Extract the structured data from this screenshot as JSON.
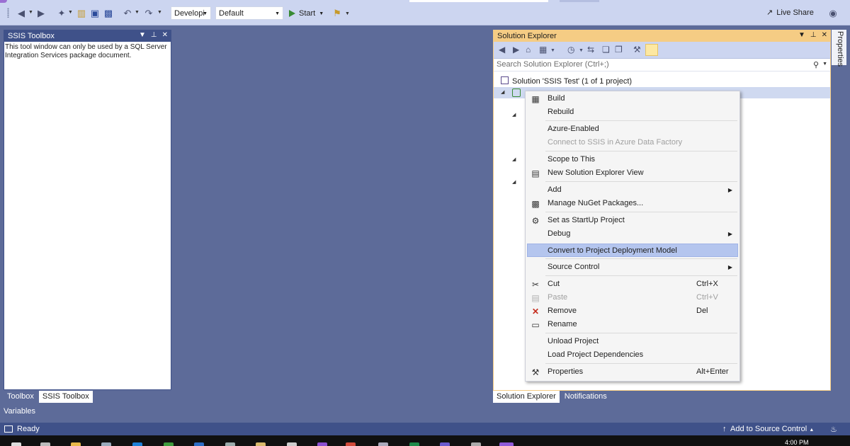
{
  "toolbar": {
    "config_combo": "Developi",
    "platform_combo": "Default",
    "start_label": "Start",
    "live_share_label": "Live Share",
    "icons": [
      "back-icon",
      "forward-icon",
      "new-project-icon",
      "open-icon",
      "save-icon",
      "save-all-icon",
      "undo-icon",
      "redo-icon",
      "find-icon"
    ]
  },
  "toolbox_panel": {
    "title": "SSIS Toolbox",
    "message": "This tool window can only be used by a SQL Server Integration Services package document."
  },
  "left_tabs": [
    "Toolbox",
    "SSIS Toolbox"
  ],
  "variables_label": "Variables",
  "solution_explorer": {
    "title": "Solution Explorer",
    "search_placeholder": "Search Solution Explorer (Ctrl+;)",
    "solution_label": "Solution 'SSIS Test' (1 of 1 project)"
  },
  "right_tabs": [
    "Solution Explorer",
    "Notifications"
  ],
  "properties_tab": "Properties",
  "context_menu": [
    {
      "label": "Build",
      "icon": "build-icon"
    },
    {
      "label": "Rebuild"
    },
    {
      "label": "Azure-Enabled"
    },
    {
      "label": "Connect to SSIS in Azure Data Factory",
      "disabled": true
    },
    {
      "label": "Scope to This"
    },
    {
      "label": "New Solution Explorer View",
      "icon": "new-view-icon"
    },
    {
      "label": "Add",
      "submenu": true
    },
    {
      "label": "Manage NuGet Packages...",
      "icon": "nuget-icon"
    },
    {
      "label": "Set as StartUp Project",
      "icon": "gear-icon"
    },
    {
      "label": "Debug",
      "submenu": true
    },
    {
      "label": "Convert to Project Deployment Model",
      "highlighted": true
    },
    {
      "label": "Source Control",
      "submenu": true
    },
    {
      "label": "Cut",
      "shortcut": "Ctrl+X",
      "icon": "scissors-icon"
    },
    {
      "label": "Paste",
      "shortcut": "Ctrl+V",
      "icon": "paste-icon",
      "disabled": true
    },
    {
      "label": "Remove",
      "shortcut": "Del",
      "icon": "remove-icon"
    },
    {
      "label": "Rename",
      "icon": "rename-icon"
    },
    {
      "label": "Unload Project"
    },
    {
      "label": "Load Project Dependencies"
    },
    {
      "label": "Properties",
      "shortcut": "Alt+Enter",
      "icon": "wrench-icon"
    }
  ],
  "status_bar": {
    "ready": "Ready",
    "source_control": "Add to Source Control"
  },
  "taskbar": {
    "clock": "4:00 PM"
  }
}
